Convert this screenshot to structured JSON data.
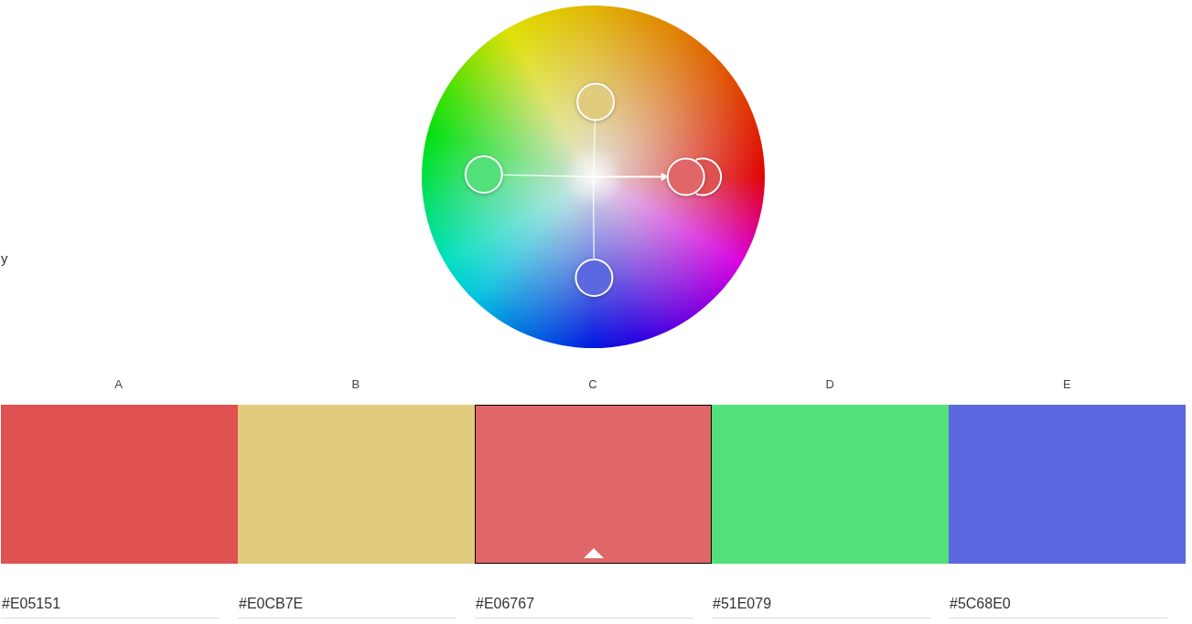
{
  "side_label": "y",
  "swatches": [
    {
      "label": "A",
      "color": "#e05151",
      "hex": "#E05151",
      "selected": false
    },
    {
      "label": "B",
      "color": "#e0cb7e",
      "hex": "#E0CB7E",
      "selected": false
    },
    {
      "label": "C",
      "color": "#e06767",
      "hex": "#E06767",
      "selected": true
    },
    {
      "label": "D",
      "color": "#51e079",
      "hex": "#51E079",
      "selected": false
    },
    {
      "label": "E",
      "color": "#5c68e0",
      "hex": "#5C68E0",
      "selected": false
    }
  ]
}
